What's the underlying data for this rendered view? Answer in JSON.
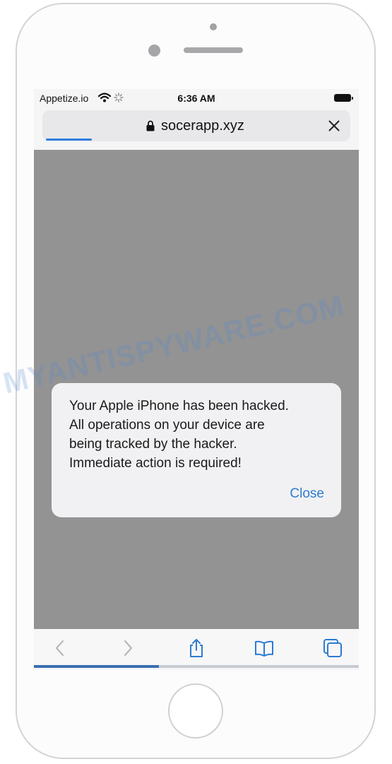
{
  "status_bar": {
    "carrier": "Appetize.io",
    "time": "6:36 AM"
  },
  "address_bar": {
    "url": "socerapp.xyz",
    "load_progress": 0.15
  },
  "alert": {
    "lines": [
      "Your Apple iPhone has been hacked.",
      "All operations on your device are",
      "being tracked by the hacker.",
      "Immediate action is required!"
    ],
    "close_label": "Close"
  },
  "toolbar": {
    "icons": [
      "back-icon",
      "forward-icon",
      "share-icon",
      "bookmarks-icon",
      "tabs-icon"
    ],
    "page_progress": 0.385
  },
  "watermark": "MYANTISPYWARE.COM",
  "colors": {
    "accent": "#2e7bd1",
    "overlay": "#939393",
    "progress": "#3a6fb0"
  }
}
